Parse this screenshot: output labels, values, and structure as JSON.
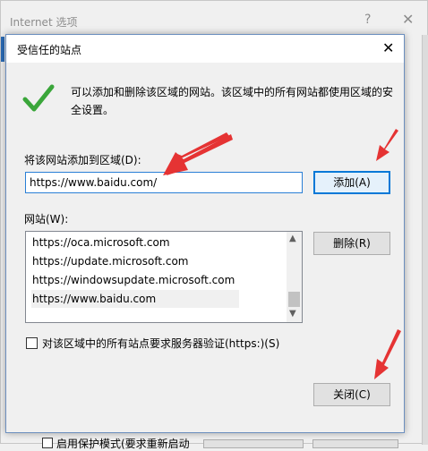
{
  "parent": {
    "title": "Internet 选项",
    "help_glyph": "?",
    "close_glyph": "✕",
    "bottom_protected_mode_label": "启用保护模式(要求重新启动"
  },
  "dialog": {
    "title": "受信任的站点",
    "close_glyph": "✕",
    "description": "可以添加和删除该区域的网站。该区域中的所有网站都使用区域的安全设置。",
    "add_label": "将该网站添加到区域(D):",
    "url_input_value": "https://www.baidu.com/",
    "add_button": "添加(A)",
    "sites_label": "网站(W):",
    "sites": [
      "https://oca.microsoft.com",
      "https://update.microsoft.com",
      "https://windowsupdate.microsoft.com",
      "https://www.baidu.com"
    ],
    "remove_button": "删除(R)",
    "https_checkbox_label": "对该区域中的所有站点要求服务器验证(https:)(S)",
    "close_button": "关闭(C)"
  },
  "icons": {
    "success": "check-icon",
    "annotation": "red-arrow-icon"
  },
  "colors": {
    "check_green": "#3aa63a",
    "arrow_red": "#e53333",
    "focus_blue": "#0078d7"
  }
}
